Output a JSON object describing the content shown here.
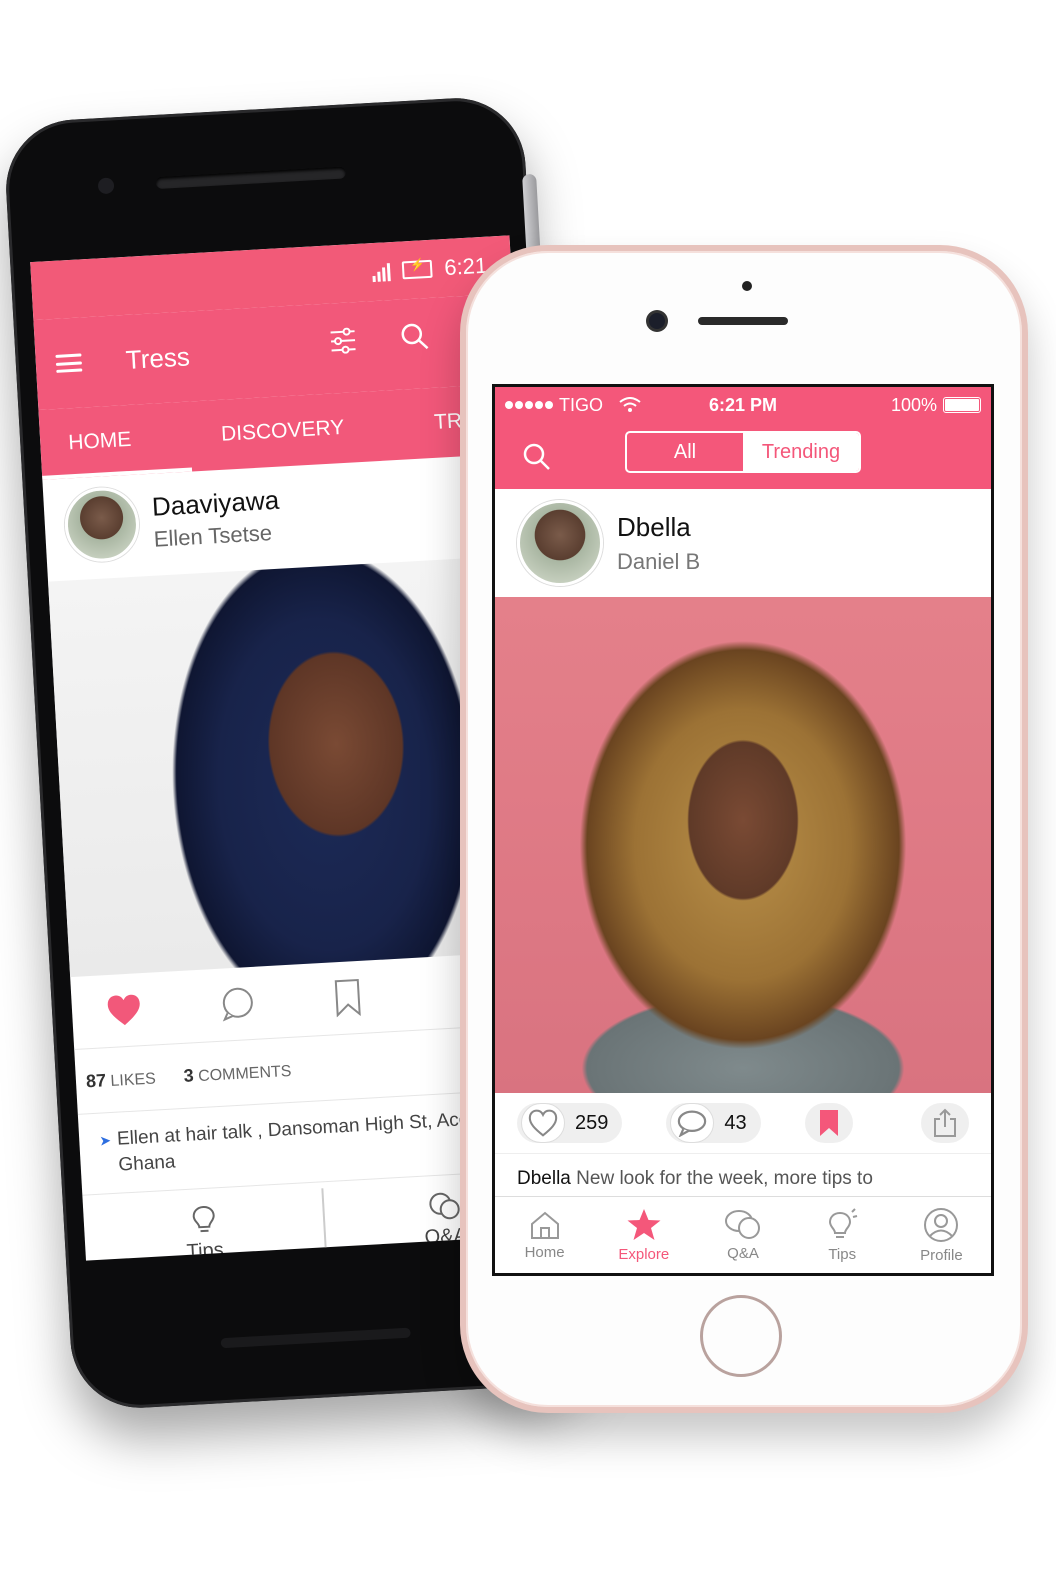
{
  "android": {
    "status": {
      "time": "6:21"
    },
    "appbar": {
      "title": "Tress"
    },
    "tabs": [
      "HOME",
      "DISCOVERY",
      "TREND"
    ],
    "post": {
      "username": "Daaviyawa",
      "name": "Ellen Tsetse",
      "likes_count": "87",
      "likes_label": "LIKES",
      "comments_count": "3",
      "comments_label": "COMMENTS",
      "location": "Ellen at  hair talk , Dansoman High St, Accra, Ghana"
    },
    "bottom_nav": {
      "tips": "Tips",
      "qa": "Q&A"
    }
  },
  "iphone": {
    "status": {
      "carrier": "TIGO",
      "time": "6:21 PM",
      "battery": "100%"
    },
    "segment": {
      "all": "All",
      "trending": "Trending"
    },
    "post": {
      "username": "Dbella",
      "name": "Daniel B",
      "likes": "259",
      "comments": "43",
      "caption_user": "Dbella",
      "caption_text": "New look for the week, more tips to"
    },
    "tabbar": {
      "home": "Home",
      "explore": "Explore",
      "qa": "Q&A",
      "tips": "Tips",
      "profile": "Profile"
    }
  },
  "colors": {
    "brand_pink": "#f4577a",
    "frame_rose_gold": "#e7c3bd"
  }
}
